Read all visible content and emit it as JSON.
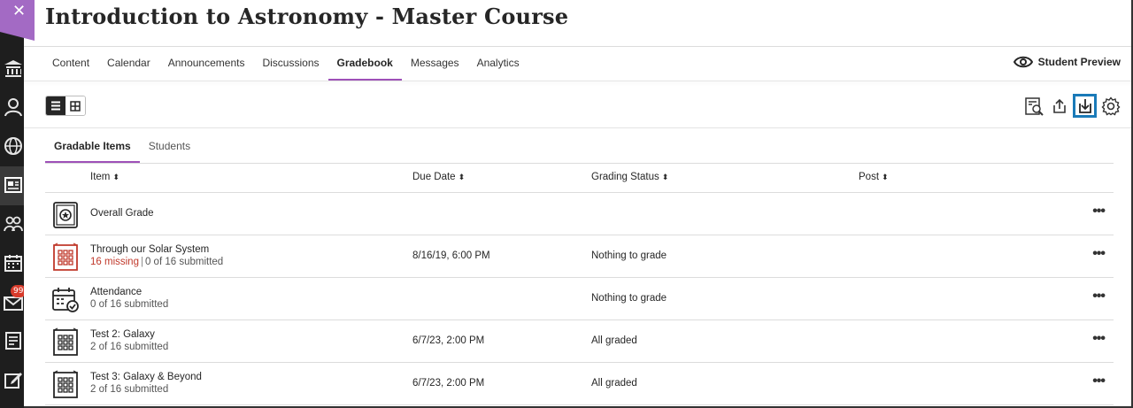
{
  "course": {
    "title": "Introduction to Astronomy - Master Course"
  },
  "nav": {
    "tabs": [
      {
        "label": "Content"
      },
      {
        "label": "Calendar"
      },
      {
        "label": "Announcements"
      },
      {
        "label": "Discussions"
      },
      {
        "label": "Gradebook"
      },
      {
        "label": "Messages"
      },
      {
        "label": "Analytics"
      }
    ],
    "active_tab": "Gradebook",
    "student_preview": "Student Preview"
  },
  "sidebar": {
    "messages_badge": "99"
  },
  "gradebook": {
    "subtabs": [
      {
        "label": "Gradable Items"
      },
      {
        "label": "Students"
      }
    ],
    "columns": {
      "item": "Item",
      "due": "Due Date",
      "status": "Grading Status",
      "post": "Post"
    },
    "rows": [
      {
        "icon": "overall-grade-icon",
        "name": "Overall Grade",
        "detail": "",
        "missing": "",
        "submitted": "",
        "due": "",
        "status": ""
      },
      {
        "icon": "assignment-icon",
        "name": "Through our Solar System",
        "missing": "16 missing",
        "submitted": "0 of 16 submitted",
        "due": "8/16/19, 6:00 PM",
        "status": "Nothing to grade"
      },
      {
        "icon": "attendance-icon",
        "name": "Attendance",
        "missing": "",
        "submitted": "0 of 16 submitted",
        "due": "",
        "status": "Nothing to grade"
      },
      {
        "icon": "test-icon",
        "name": "Test 2: Galaxy",
        "missing": "",
        "submitted": "2 of 16 submitted",
        "due": "6/7/23, 2:00 PM",
        "status": "All graded"
      },
      {
        "icon": "test-icon",
        "name": "Test 3: Galaxy & Beyond",
        "missing": "",
        "submitted": "2 of 16 submitted",
        "due": "6/7/23, 2:00 PM",
        "status": "All graded"
      }
    ]
  },
  "colors": {
    "accent": "#9e50b8",
    "missing": "#c0392b",
    "focus": "#1a7ab8",
    "leftnav": "#1e1e1e"
  }
}
